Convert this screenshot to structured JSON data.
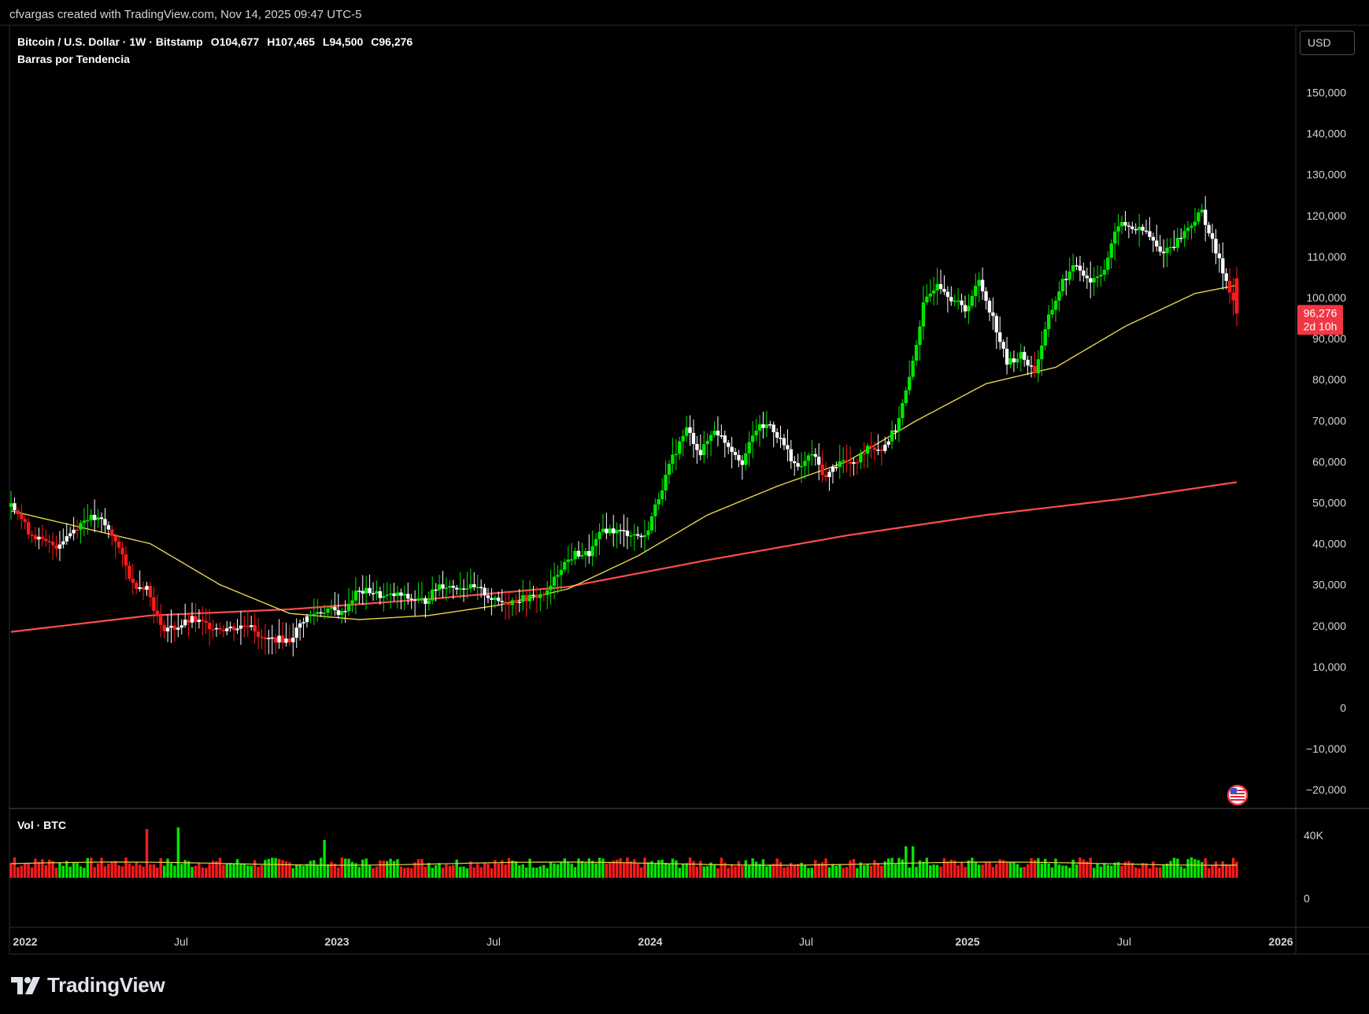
{
  "watermark": "cfvargas created with TradingView.com, Nov 14, 2025 09:47 UTC-5",
  "symbol": {
    "name": "Bitcoin / U.S. Dollar · 1W · Bitstamp",
    "open": "O104,677",
    "high": "H107,465",
    "low": "L94,500",
    "close": "C96,276"
  },
  "indicator_label": "Barras por Tendencia",
  "volume_label": "Vol · BTC",
  "currency_button": "USD",
  "price_badge": {
    "price": "96,276",
    "countdown": "2d 10h"
  },
  "brand": "TradingView",
  "colors": {
    "up": "#00e600",
    "down": "#ff1a1a",
    "neutral": "#ffffff",
    "ma_fast": "#e6d54a",
    "ma_slow": "#ff4d4d",
    "price_badge": "#f23645"
  },
  "chart_data": {
    "type": "candlestick",
    "timeframe": "1W",
    "x_ticks": [
      "2022",
      "Jul",
      "2023",
      "Jul",
      "2024",
      "Jul",
      "2025",
      "Jul",
      "2026"
    ],
    "y_ticks": [
      150000,
      140000,
      130000,
      120000,
      110000,
      100000,
      90000,
      80000,
      70000,
      60000,
      50000,
      40000,
      30000,
      20000,
      10000,
      0,
      -10000,
      -20000
    ],
    "y_tick_labels": [
      "150,000",
      "140,000",
      "130,000",
      "120,000",
      "110,000",
      "100,000",
      "90,000",
      "80,000",
      "70,000",
      "60,000",
      "50,000",
      "40,000",
      "30,000",
      "20,000",
      "10,000",
      "0",
      "−10,000",
      "−20,000"
    ],
    "ylim": [
      -24000,
      162000
    ],
    "volume_ticks": [
      "40K",
      "0"
    ],
    "close_series": [
      [
        0,
        50500
      ],
      [
        5,
        43000
      ],
      [
        9,
        40500
      ],
      [
        13,
        39500
      ],
      [
        18,
        43500
      ],
      [
        22,
        46500
      ],
      [
        26,
        45500
      ],
      [
        30,
        41000
      ],
      [
        35,
        30000
      ],
      [
        39,
        29500
      ],
      [
        43,
        19500
      ],
      [
        47,
        19500
      ],
      [
        52,
        21500
      ],
      [
        57,
        20000
      ],
      [
        61,
        19300
      ],
      [
        65,
        19600
      ],
      [
        69,
        20600
      ],
      [
        72,
        16500
      ],
      [
        76,
        16800
      ],
      [
        80,
        16500
      ],
      [
        84,
        21500
      ],
      [
        87,
        23000
      ],
      [
        91,
        24000
      ],
      [
        95,
        23000
      ],
      [
        99,
        28000
      ],
      [
        103,
        28500
      ],
      [
        107,
        27000
      ],
      [
        111,
        27500
      ],
      [
        115,
        26500
      ],
      [
        119,
        26000
      ],
      [
        123,
        30000
      ],
      [
        127,
        29500
      ],
      [
        131,
        29500
      ],
      [
        135,
        28500
      ],
      [
        139,
        26000
      ],
      [
        143,
        25800
      ],
      [
        146,
        26500
      ],
      [
        150,
        27000
      ],
      [
        154,
        28000
      ],
      [
        158,
        34500
      ],
      [
        162,
        37500
      ],
      [
        166,
        37500
      ],
      [
        170,
        43500
      ],
      [
        174,
        43000
      ],
      [
        178,
        42500
      ],
      [
        182,
        41500
      ],
      [
        186,
        51500
      ],
      [
        190,
        61000
      ],
      [
        194,
        68000
      ],
      [
        198,
        62000
      ],
      [
        202,
        68000
      ],
      [
        206,
        64000
      ],
      [
        210,
        60000
      ],
      [
        214,
        68000
      ],
      [
        218,
        69000
      ],
      [
        222,
        64000
      ],
      [
        226,
        58000
      ],
      [
        230,
        62000
      ],
      [
        234,
        56000
      ],
      [
        238,
        60500
      ],
      [
        242,
        59000
      ],
      [
        246,
        64000
      ],
      [
        250,
        63000
      ],
      [
        254,
        68000
      ],
      [
        258,
        80000
      ],
      [
        262,
        98000
      ],
      [
        266,
        104000
      ],
      [
        270,
        100000
      ],
      [
        274,
        97000
      ],
      [
        278,
        104000
      ],
      [
        282,
        95000
      ],
      [
        286,
        84000
      ],
      [
        290,
        86000
      ],
      [
        294,
        82000
      ],
      [
        298,
        95000
      ],
      [
        302,
        104000
      ],
      [
        306,
        108000
      ],
      [
        310,
        104000
      ],
      [
        314,
        107000
      ],
      [
        318,
        118000
      ],
      [
        322,
        117000
      ],
      [
        326,
        116000
      ],
      [
        330,
        111000
      ],
      [
        334,
        113000
      ],
      [
        338,
        117000
      ],
      [
        342,
        121000
      ],
      [
        346,
        111000
      ],
      [
        350,
        102000
      ],
      [
        352,
        96276
      ]
    ],
    "ma_fast": [
      [
        0,
        48000
      ],
      [
        20,
        44000
      ],
      [
        40,
        40000
      ],
      [
        60,
        30000
      ],
      [
        80,
        23000
      ],
      [
        100,
        21500
      ],
      [
        120,
        22500
      ],
      [
        140,
        25000
      ],
      [
        160,
        29000
      ],
      [
        180,
        37000
      ],
      [
        200,
        47000
      ],
      [
        220,
        54000
      ],
      [
        240,
        60000
      ],
      [
        260,
        70000
      ],
      [
        280,
        79000
      ],
      [
        300,
        83000
      ],
      [
        320,
        93000
      ],
      [
        340,
        101000
      ],
      [
        352,
        103000
      ]
    ],
    "ma_slow": [
      [
        0,
        18500
      ],
      [
        40,
        22500
      ],
      [
        80,
        24000
      ],
      [
        120,
        26500
      ],
      [
        160,
        29500
      ],
      [
        200,
        36000
      ],
      [
        240,
        42000
      ],
      [
        280,
        47000
      ],
      [
        320,
        51000
      ],
      [
        352,
        55000
      ]
    ]
  }
}
